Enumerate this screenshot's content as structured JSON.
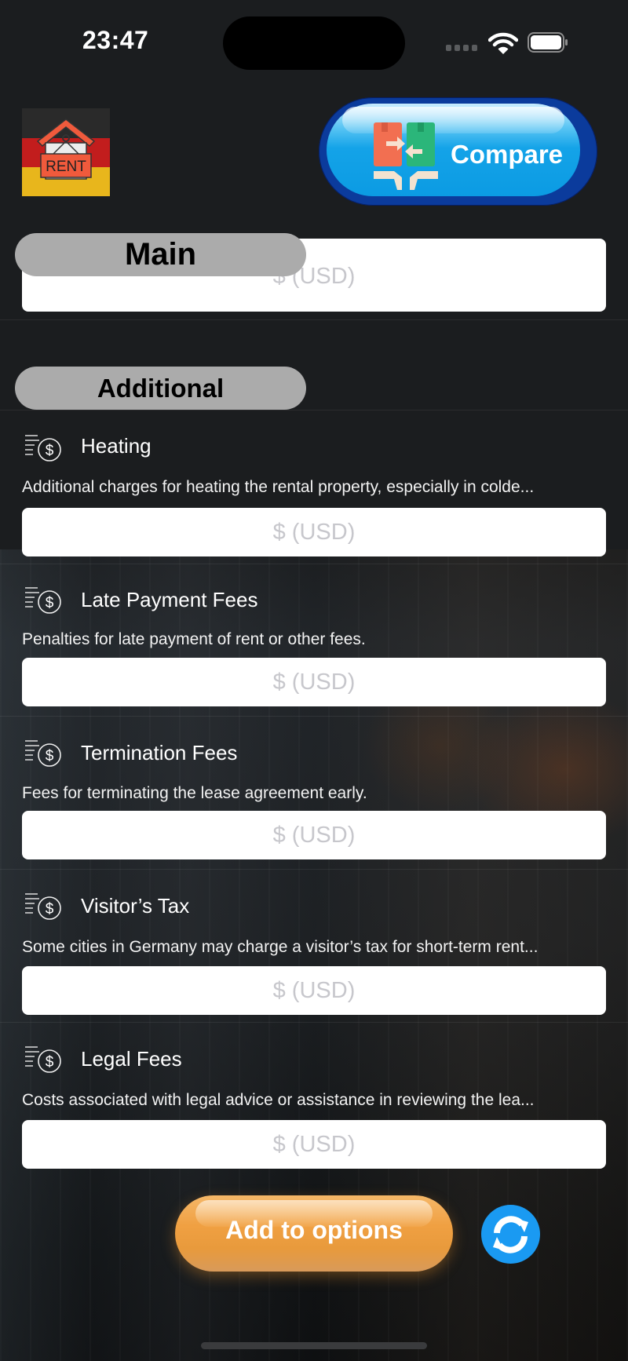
{
  "status_bar": {
    "time": "23:47",
    "icons": [
      "signal-dots-icon",
      "wifi-icon",
      "battery-icon"
    ]
  },
  "header": {
    "logo": {
      "icon": "rent-house-germany-flag-logo",
      "text": "RENT"
    },
    "compare_button": {
      "label": "Compare",
      "icon": "compare-boxes-icon"
    }
  },
  "sections": {
    "main": {
      "label": "Main",
      "input": {
        "placeholder": "$ (USD)",
        "value": ""
      }
    },
    "additional": {
      "label": "Additional",
      "items": [
        {
          "icon": "money-dollar-icon",
          "title": "Heating",
          "description": "Additional charges for heating the rental property, especially in colde...",
          "placeholder": "$ (USD)",
          "value": ""
        },
        {
          "icon": "money-dollar-icon",
          "title": "Late Payment Fees",
          "description": "Penalties for late payment of rent or other fees.",
          "placeholder": "$ (USD)",
          "value": ""
        },
        {
          "icon": "money-dollar-icon",
          "title": "Termination Fees",
          "description": "Fees for terminating the lease agreement early.",
          "placeholder": "$ (USD)",
          "value": ""
        },
        {
          "icon": "money-dollar-icon",
          "title": "Visitor’s Tax",
          "description": "Some cities in Germany may charge a visitor’s tax for short-term rent...",
          "placeholder": "$ (USD)",
          "value": ""
        },
        {
          "icon": "money-dollar-icon",
          "title": "Legal Fees",
          "description": "Costs associated with legal advice or assistance in reviewing the lea...",
          "placeholder": "$ (USD)",
          "value": ""
        }
      ]
    }
  },
  "footer": {
    "add_button": {
      "label": "Add to options"
    },
    "refresh_button": {
      "icon": "refresh-icon"
    }
  },
  "colors": {
    "background": "#1b1d1f",
    "pill": "#ababab",
    "compare_blue": "#14a3e8",
    "add_orange": "#f0a042",
    "refresh_blue": "#1a9af2",
    "placeholder": "#c7c7cc"
  }
}
